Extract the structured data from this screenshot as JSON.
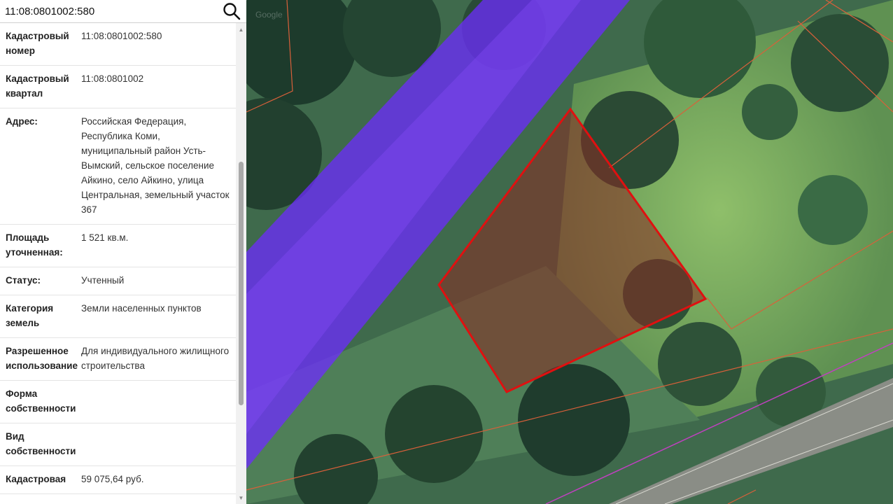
{
  "search": {
    "value": "11:08:0801002:580",
    "button_icon": "search-icon"
  },
  "map": {
    "watermark": "Google",
    "parcel_color": "#e01010",
    "road_zone_color": "#7a3cff",
    "boundary_color": "#d9603a"
  },
  "details": [
    {
      "label": "Кадастровый номер",
      "value": "11:08:0801002:580"
    },
    {
      "label": "Кадастровый квартал",
      "value": "11:08:0801002"
    },
    {
      "label": "Адрес:",
      "value": "Российская Федерация, Республика Коми, муниципальный район Усть-Вымский, сельское поселение Айкино, село Айкино, улица Центральная, земельный участок 367"
    },
    {
      "label": "Площадь уточненная:",
      "value": "1 521 кв.м."
    },
    {
      "label": "Статус:",
      "value": "Учтенный"
    },
    {
      "label": "Категория земель",
      "value": "Земли населенных пунктов"
    },
    {
      "label": "Разрешенное использование",
      "value": "Для индивидуального жилищного строительства"
    },
    {
      "label": "Форма собственности",
      "value": ""
    },
    {
      "label": "Вид собственности",
      "value": ""
    },
    {
      "label": "Кадастровая",
      "value": "59 075,64 руб."
    }
  ]
}
